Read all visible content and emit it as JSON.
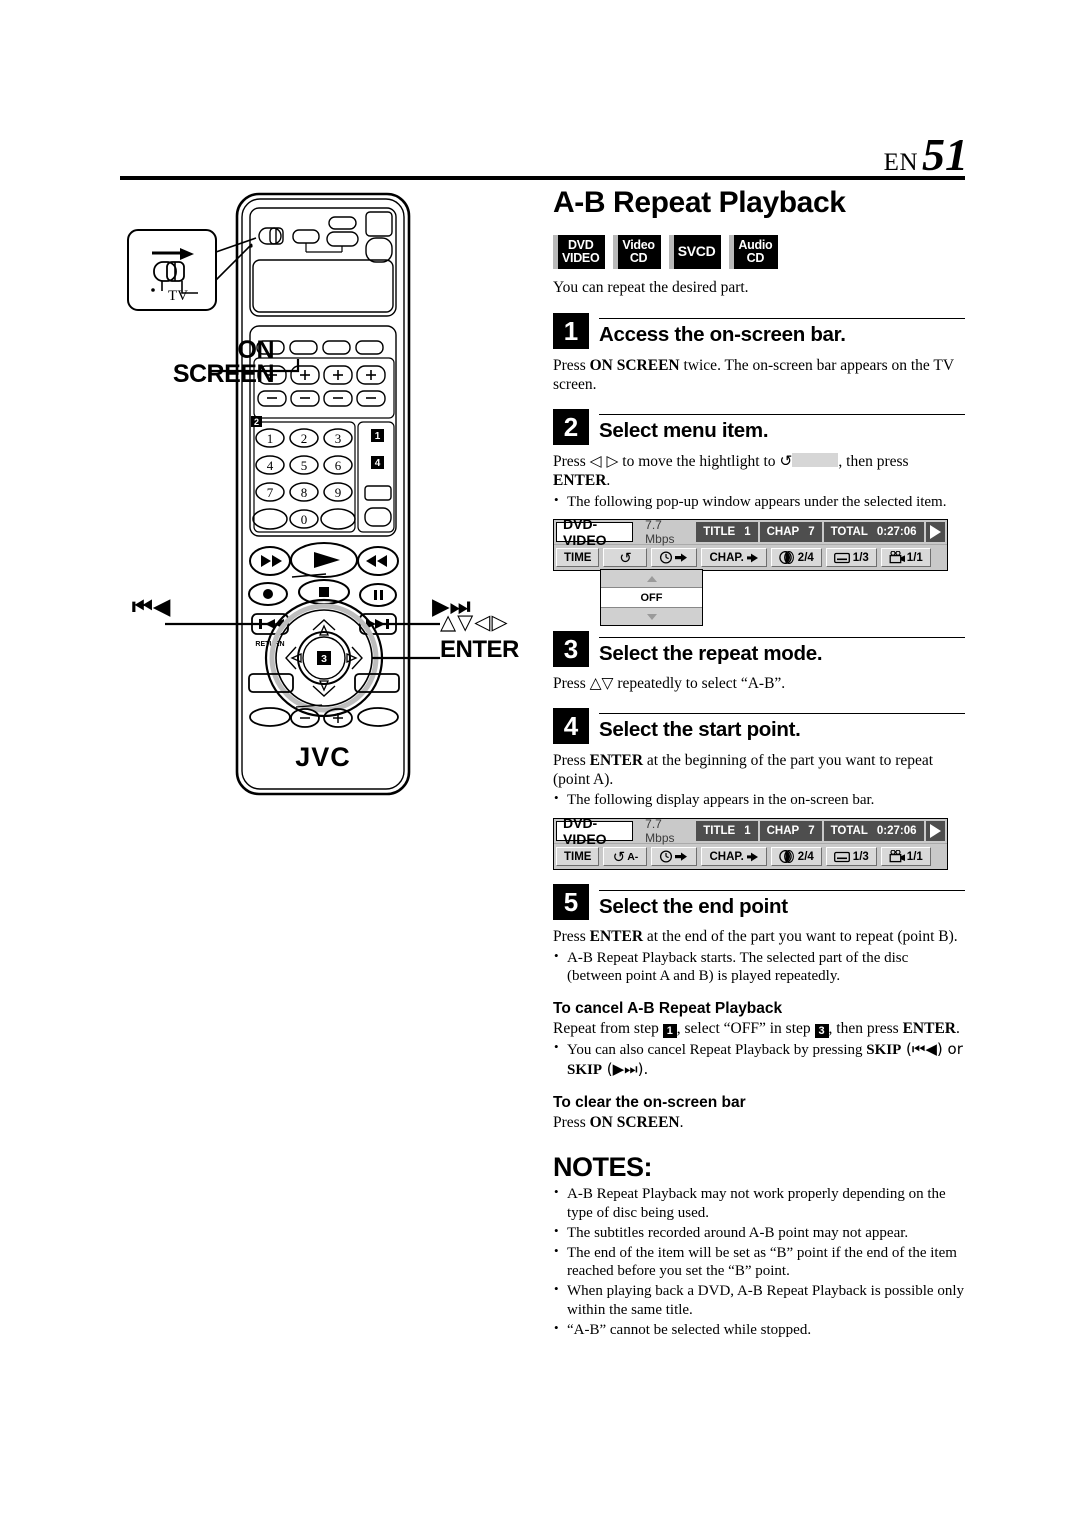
{
  "header": {
    "en_label": "EN",
    "page_number": "51"
  },
  "title": "A-B Repeat Playback",
  "disc_badges": [
    {
      "line1": "DVD",
      "line2": "VIDEO"
    },
    {
      "line1": "Video",
      "line2": "CD"
    },
    {
      "line1": "SVCD",
      "line2": ""
    },
    {
      "line1": "Audio",
      "line2": "CD"
    }
  ],
  "lead": "You can repeat the desired part.",
  "steps": [
    {
      "num": "1",
      "title": "Access the on-screen bar.",
      "body_pre": "Press ",
      "body_bold": "ON SCREEN",
      "body_post": " twice. The on-screen bar appears on the TV screen."
    },
    {
      "num": "2",
      "title": "Select menu item.",
      "body_pre": "Press ",
      "arrows": "◁ ▷",
      "body_mid": " to move the hightlight to ",
      "repeat_icon": "↺",
      "body_post": ", then press ",
      "body_bold": "ENTER",
      "body_end": ".",
      "bullet": "The following pop-up window appears under the selected item."
    },
    {
      "num": "3",
      "title": "Select the repeat mode.",
      "body_pre": "Press ",
      "arrows": "△▽",
      "body_post": " repeatedly to select “A-B”."
    },
    {
      "num": "4",
      "title": "Select the start point.",
      "body_pre": "Press ",
      "body_bold": "ENTER",
      "body_post": " at the beginning of the part you want to repeat (point A).",
      "bullet": "The following display appears in the on-screen bar."
    },
    {
      "num": "5",
      "title": "Select the end point",
      "body_pre": "Press ",
      "body_bold": "ENTER",
      "body_post": " at the end of the part you want to repeat (point B).",
      "bullet": "A-B Repeat Playback starts. The selected part of the disc (between point A and B) is played repeatedly."
    }
  ],
  "osd_bar_1": {
    "disc_name": "DVD-VIDEO",
    "bitrate": "7.7 Mbps",
    "title_label": "TITLE",
    "title_value": "1",
    "chap_label": "CHAP",
    "chap_value": "7",
    "total_label": "TOTAL",
    "total_value": "0:27:06",
    "play_icon": "play-triangle",
    "time_button": "TIME",
    "repeat_icon": "↺",
    "repeat_suffix": "",
    "clock_button": "clock-arrow",
    "chap_button": "CHAP.",
    "audio_value": "2/4",
    "subtitle_value": "1/3",
    "angle_value": "1/1",
    "popup": {
      "up_arrow": "△",
      "value": "OFF",
      "down_arrow": "▽"
    }
  },
  "osd_bar_2": {
    "disc_name": "DVD-VIDEO",
    "bitrate": "7.7 Mbps",
    "title_label": "TITLE",
    "title_value": "1",
    "chap_label": "CHAP",
    "chap_value": "7",
    "total_label": "TOTAL",
    "total_value": "0:27:06",
    "play_icon": "play-triangle",
    "time_button": "TIME",
    "repeat_icon": "↺",
    "repeat_suffix": "A-",
    "clock_button": "clock-arrow",
    "chap_button": "CHAP.",
    "audio_value": "2/4",
    "subtitle_value": "1/3",
    "angle_value": "1/1"
  },
  "cancel_section": {
    "heading": "To cancel A-B Repeat Playback",
    "body_pre": "Repeat from step ",
    "step_a": "1",
    "body_mid": ", select “OFF” in step ",
    "step_b": "3",
    "body_post": ", then press ",
    "body_bold": "ENTER",
    "body_end": ".",
    "bullet_pre": "You can also cancel Repeat Playback by pressing ",
    "bullet_bold1": "SKIP",
    "bullet_mid1": " (⏮◀) or ",
    "bullet_bold2": "SKIP",
    "bullet_end": " (▶⏭)."
  },
  "clear_section": {
    "heading": "To clear the on-screen bar",
    "body_pre": "Press ",
    "body_bold": "ON SCREEN",
    "body_end": "."
  },
  "notes": {
    "heading": "NOTES:",
    "items": [
      "A-B Repeat Playback may not work properly depending on the type of disc being used.",
      "The subtitles recorded around A-B point may not appear.",
      "The end of the item will be set as “B” point if the end of the item reached before you set the “B” point.",
      "When playing back a DVD, A-B Repeat Playback is possible only within the same title.",
      "“A-B” cannot be selected while stopped."
    ]
  },
  "remote": {
    "brand": "JVC",
    "callout_tv": "TV",
    "label_on_screen_line1": "ON",
    "label_on_screen_line2": "SCREEN",
    "label_enter": "ENTER",
    "label_arrows": "△▽◁▷",
    "label_skip_prev": "⏮◀",
    "label_skip_next": "▶⏭",
    "keypad": [
      "1",
      "2",
      "3",
      "4",
      "5",
      "6",
      "7",
      "8",
      "9",
      "0"
    ],
    "step_marker_keypad": "2",
    "step_marker_enter": "3",
    "step_marker_side_top": "1",
    "step_marker_side_bottom": "4"
  }
}
